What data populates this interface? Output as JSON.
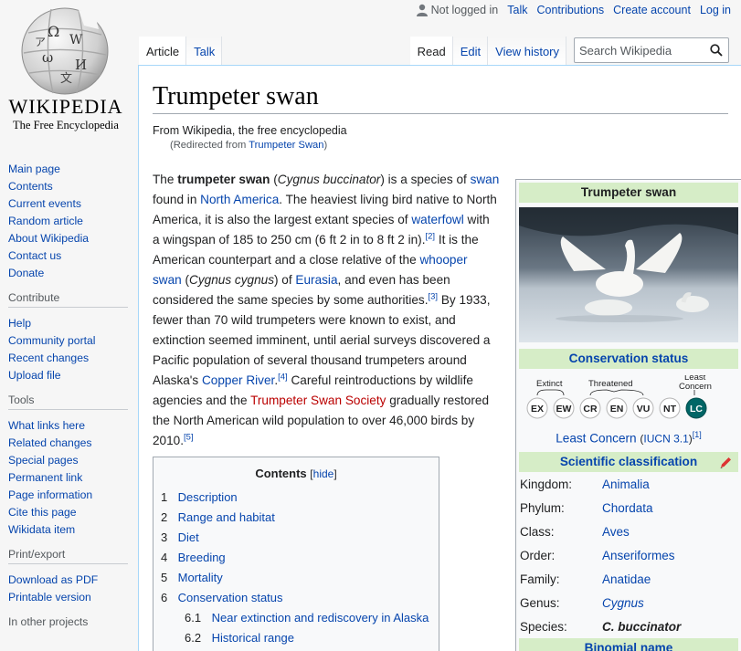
{
  "personal": {
    "not_logged_in": "Not logged in",
    "talk": "Talk",
    "contributions": "Contributions",
    "create_account": "Create account",
    "login": "Log in"
  },
  "logo": {
    "wordmark": "WIKIPEDIA",
    "tagline": "The Free Encyclopedia"
  },
  "sidebar": {
    "nav": [
      "Main page",
      "Contents",
      "Current events",
      "Random article",
      "About Wikipedia",
      "Contact us",
      "Donate"
    ],
    "contribute": {
      "heading": "Contribute",
      "items": [
        "Help",
        "Community portal",
        "Recent changes",
        "Upload file"
      ]
    },
    "tools": {
      "heading": "Tools",
      "items": [
        "What links here",
        "Related changes",
        "Special pages",
        "Permanent link",
        "Page information",
        "Cite this page",
        "Wikidata item"
      ]
    },
    "print": {
      "heading": "Print/export",
      "items": [
        "Download as PDF",
        "Printable version"
      ]
    },
    "other": {
      "heading": "In other projects"
    }
  },
  "tabs": {
    "article": "Article",
    "talk": "Talk",
    "read": "Read",
    "edit": "Edit",
    "history": "View history",
    "search_placeholder": "Search Wikipedia"
  },
  "article": {
    "title": "Trumpeter swan",
    "tagline": "From Wikipedia, the free encyclopedia",
    "redirect_prefix": "(Redirected from ",
    "redirect_link": "Trumpeter Swan",
    "redirect_suffix": ")",
    "lead": {
      "t1": "The ",
      "b1": "trumpeter swan",
      "t2": " (",
      "i1": "Cygnus buccinator",
      "t3": ") is a species of ",
      "l1": "swan",
      "t4": " found in ",
      "l2": "North America",
      "t5": ". The heaviest living bird native to North America, it is also the largest extant species of ",
      "l3": "waterfowl",
      "t6": " with a wingspan of 185 to 250 cm (6 ft 2 in to 8 ft 2 in).",
      "r1": "[2]",
      "t7": " It is the American counterpart and a close relative of the ",
      "l4": "whooper swan",
      "t8": " (",
      "i2": "Cygnus cygnus",
      "t9": ") of ",
      "l5": "Eurasia",
      "t10": ", and even has been considered the same species by some authorities.",
      "r2": "[3]",
      "t11": " By 1933, fewer than 70 wild trumpeters were known to exist, and extinction seemed imminent, until aerial surveys discovered a Pacific population of several thousand trumpeters around Alaska's ",
      "l6": "Copper River",
      "t12": ".",
      "r3": "[4]",
      "t13": " Careful reintroductions by wildlife agencies and the ",
      "l7": "Trumpeter Swan Society",
      "t14": " gradually restored the North American wild population to over 46,000 birds by 2010.",
      "r4": "[5]"
    }
  },
  "toc": {
    "title": "Contents",
    "hide": "hide",
    "items": [
      {
        "num": "1",
        "label": "Description"
      },
      {
        "num": "2",
        "label": "Range and habitat"
      },
      {
        "num": "3",
        "label": "Diet"
      },
      {
        "num": "4",
        "label": "Breeding"
      },
      {
        "num": "5",
        "label": "Mortality"
      },
      {
        "num": "6",
        "label": "Conservation status"
      },
      {
        "num": "6.1",
        "label": "Near extinction and rediscovery in Alaska"
      },
      {
        "num": "6.2",
        "label": "Historical range"
      }
    ]
  },
  "infobox": {
    "title": "Trumpeter swan",
    "conservation_heading": "Conservation status",
    "iucn_labels": {
      "extinct": "Extinct",
      "threatened": "Threatened",
      "least": "Least",
      "concern": "Concern"
    },
    "iucn_codes": [
      "EX",
      "EW",
      "CR",
      "EN",
      "VU",
      "NT",
      "LC"
    ],
    "status_link": "Least Concern",
    "status_src_open": "(",
    "status_src": "IUCN 3.1",
    "status_src_close": ")",
    "status_ref": "[1]",
    "sci_heading": "Scientific classification",
    "taxonomy": [
      {
        "rank": "Kingdom:",
        "value": "Animalia"
      },
      {
        "rank": "Phylum:",
        "value": "Chordata"
      },
      {
        "rank": "Class:",
        "value": "Aves"
      },
      {
        "rank": "Order:",
        "value": "Anseriformes"
      },
      {
        "rank": "Family:",
        "value": "Anatidae"
      },
      {
        "rank": "Genus:",
        "value": "Cygnus"
      },
      {
        "rank": "Species:",
        "value": "C. buccinator"
      }
    ],
    "binomial_heading": "Binomial name"
  },
  "colors": {
    "link": "#0645ad",
    "red_link": "#ba0000",
    "infobox_header": "#d6edc7",
    "lc_badge": "#006666"
  }
}
